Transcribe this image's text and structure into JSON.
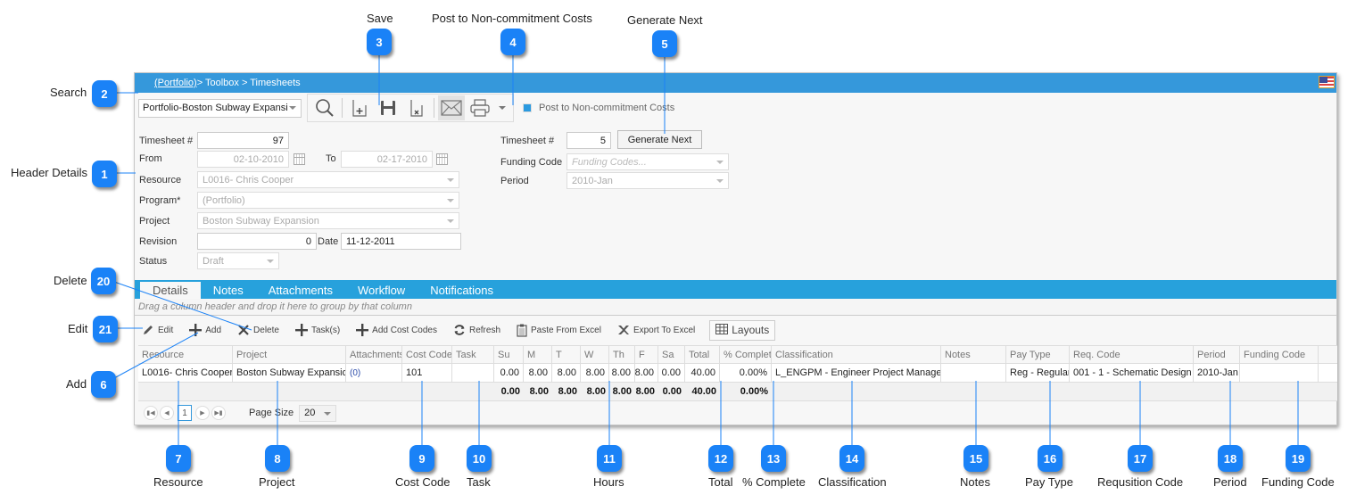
{
  "callouts": [
    {
      "num": "1",
      "label": "Header Details"
    },
    {
      "num": "2",
      "label": "Search"
    },
    {
      "num": "3",
      "label": "Save"
    },
    {
      "num": "4",
      "label": "Post to Non-commitment Costs"
    },
    {
      "num": "5",
      "label": "Generate Next"
    },
    {
      "num": "6",
      "label": "Add"
    },
    {
      "num": "7",
      "label": "Resource"
    },
    {
      "num": "8",
      "label": "Project"
    },
    {
      "num": "9",
      "label": "Cost Code"
    },
    {
      "num": "10",
      "label": "Task"
    },
    {
      "num": "11",
      "label": "Hours"
    },
    {
      "num": "12",
      "label": "Total"
    },
    {
      "num": "13",
      "label": "% Complete"
    },
    {
      "num": "14",
      "label": "Classification"
    },
    {
      "num": "15",
      "label": "Notes"
    },
    {
      "num": "16",
      "label": "Pay Type"
    },
    {
      "num": "17",
      "label": "Requsition Code"
    },
    {
      "num": "18",
      "label": "Period"
    },
    {
      "num": "19",
      "label": "Funding Code"
    },
    {
      "num": "20",
      "label": "Delete"
    },
    {
      "num": "21",
      "label": "Edit"
    }
  ],
  "breadcrumb": {
    "root": "(Portfolio)",
    "rest": " > Toolbox > Timesheets"
  },
  "toolbar": {
    "portfolio_select": "Portfolio-Boston Subway Expansi",
    "post_checkbox_label": "Post to Non-commitment Costs",
    "post_checkbox_checked": true
  },
  "header": {
    "timesheet_label": "Timesheet #",
    "timesheet_value": "97",
    "from_label": "From",
    "from_value": "02-10-2010",
    "to_label": "To",
    "to_value": "02-17-2010",
    "resource_label": "Resource",
    "resource_value": "L0016- Chris Cooper",
    "program_label": "Program*",
    "program_value": "(Portfolio)",
    "project_label": "Project",
    "project_value": "Boston Subway Expansion",
    "revision_label": "Revision",
    "revision_value": "0",
    "date_label": "Date",
    "date_value": "11-12-2011",
    "status_label": "Status",
    "status_value": "Draft",
    "timesheet2_label": "Timesheet #",
    "timesheet2_value": "5",
    "generate_next": "Generate Next",
    "funding_label": "Funding Code",
    "funding_placeholder": "Funding Codes...",
    "period_label": "Period",
    "period_value": "2010-Jan"
  },
  "tabs": [
    "Details",
    "Notes",
    "Attachments",
    "Workflow",
    "Notifications"
  ],
  "active_tab": "Details",
  "group_hint": "Drag a column header and drop it here to group by that column",
  "grid_tools": {
    "edit": "Edit",
    "add": "Add",
    "delete": "Delete",
    "tasks": "Task(s)",
    "add_cost_codes": "Add Cost Codes",
    "refresh": "Refresh",
    "paste": "Paste From Excel",
    "export": "Export To Excel",
    "layouts": "Layouts"
  },
  "grid": {
    "columns": [
      "Resource",
      "Project",
      "Attachments",
      "Cost Code",
      "Task",
      "Su",
      "M",
      "T",
      "W",
      "Th",
      "F",
      "Sa",
      "Total",
      "% Complet",
      "Classification",
      "Notes",
      "Pay Type",
      "Req. Code",
      "Period",
      "Funding Code"
    ],
    "rows": [
      [
        "L0016- Chris Cooper",
        "Boston Subway Expansion",
        "(0)",
        "101",
        "",
        "0.00",
        "8.00",
        "8.00",
        "8.00",
        "8.00",
        "8.00",
        "0.00",
        "40.00",
        "0.00%",
        "L_ENGPM - Engineer Project Manager",
        "",
        "Reg - Regular",
        "001 - 1 - Schematic Design",
        "2010-Jan",
        ""
      ]
    ],
    "totals": [
      "",
      "",
      "",
      "",
      "",
      "0.00",
      "8.00",
      "8.00",
      "8.00",
      "8.00",
      "8.00",
      "0.00",
      "40.00",
      "0.00%",
      "",
      "",
      "",
      "",
      "",
      ""
    ]
  },
  "pager": {
    "current_page": "1",
    "page_size_label": "Page Size",
    "page_size": "20"
  }
}
